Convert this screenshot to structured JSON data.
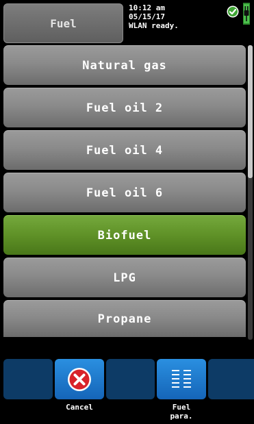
{
  "header": {
    "title": "Fuel",
    "status_time": "10:12 am",
    "status_date": "05/15/17",
    "status_wlan": "WLAN ready."
  },
  "fuel_list": {
    "items": [
      {
        "label": "Natural gas",
        "selected": false
      },
      {
        "label": "Fuel oil 2",
        "selected": false
      },
      {
        "label": "Fuel oil 4",
        "selected": false
      },
      {
        "label": "Fuel oil 6",
        "selected": false
      },
      {
        "label": "Biofuel",
        "selected": true
      },
      {
        "label": "LPG",
        "selected": false
      },
      {
        "label": "Propane",
        "selected": false
      }
    ]
  },
  "toolbar": {
    "cancel_label": "Cancel",
    "fuel_para_label": "Fuel\npara."
  },
  "icons": {
    "status_ok": "check-circle-icon",
    "power": "plug-icon",
    "cancel": "x-circle-icon",
    "parameters": "list-lines-icon"
  },
  "colors": {
    "selected": "#5f9127",
    "item": "#8a8a8a",
    "toolbar_button": "#0d3b66",
    "toolbar_active": "#1e7bd0",
    "cancel_red": "#d8232a"
  }
}
